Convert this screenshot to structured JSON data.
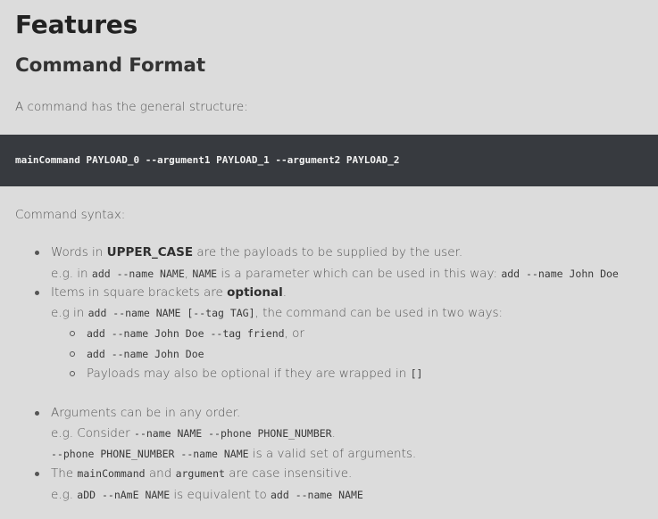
{
  "heading": "Features",
  "subheading": "Command Format",
  "intro": "A command has the general structure:",
  "code_block": "mainCommand PAYLOAD_0 --argument1 PAYLOAD_1 --argument2 PAYLOAD_2",
  "syntax_label": "Command syntax:",
  "items": {
    "upper": {
      "a": "Words in ",
      "b": "UPPER_CASE",
      "c": " are the payloads to be supplied by the user.",
      "eg_a": "e.g. in ",
      "eg_code1": "add --name NAME",
      "eg_b": ", ",
      "eg_code2": "NAME",
      "eg_c": " is a parameter which can be used in this way: ",
      "eg_code3": "add --name John Doe"
    },
    "optional": {
      "a": "Items in square brackets are ",
      "b": "optional",
      "c": ".",
      "eg_a": "e.g in ",
      "eg_code": "add --name NAME [--tag TAG]",
      "eg_b": ", the command can be used in two ways:",
      "sub1_code": "add --name John Doe --tag friend",
      "sub1_text": ", or",
      "sub2_code": "add --name John Doe",
      "sub3_text": "Payloads may also be optional if they are wrapped in ",
      "sub3_code": "[]"
    },
    "order": {
      "text": "Arguments can be in any order.",
      "eg_a": "e.g. Consider ",
      "eg_code": "--name NAME --phone PHONE_NUMBER",
      "eg_b": ".",
      "eg2_code": "--phone PHONE_NUMBER --name NAME",
      "eg2_text": " is a valid set of arguments."
    },
    "case": {
      "a": "The ",
      "code1": "mainCommand",
      "b": " and ",
      "code2": "argument",
      "c": " are case insensitive.",
      "eg_a": "e.g. ",
      "eg_code1": "aDD --nAmE NAME",
      "eg_b": " is equivalent to ",
      "eg_code2": "add --name NAME"
    }
  }
}
